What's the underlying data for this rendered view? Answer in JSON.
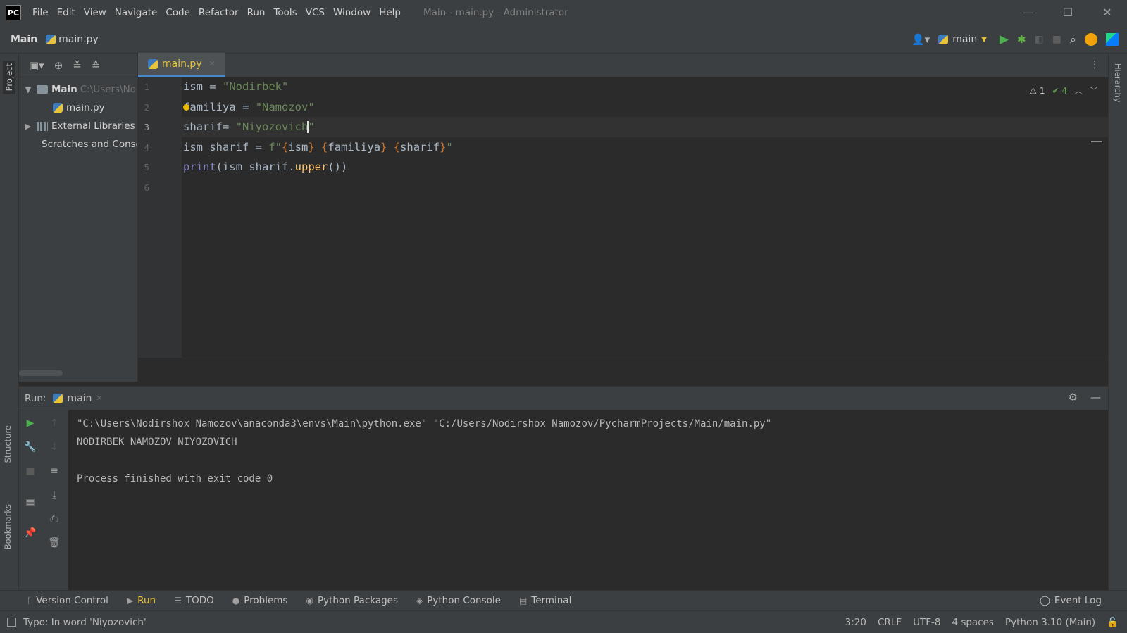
{
  "app": {
    "logo": "PC",
    "window_title": "Main - main.py - Administrator",
    "menu": [
      "File",
      "Edit",
      "View",
      "Navigate",
      "Code",
      "Refactor",
      "Run",
      "Tools",
      "VCS",
      "Window",
      "Help"
    ],
    "controls": {
      "minimize": "—",
      "maximize": "☐",
      "close": "✕"
    }
  },
  "navbar": {
    "project": "Main",
    "file": "main.py",
    "run_config": "main"
  },
  "left_strip": {
    "project": "Project",
    "structure": "Structure",
    "bookmarks": "Bookmarks"
  },
  "right_strip": {
    "hierarchy": "Hierarchy"
  },
  "project_tree": {
    "root": "Main",
    "root_path": "C:\\Users\\No",
    "file": "main.py",
    "external": "External Libraries",
    "scratches": "Scratches and Consoles"
  },
  "editor": {
    "tab": "main.py",
    "line_numbers": [
      "1",
      "2",
      "3",
      "4",
      "5",
      "6"
    ],
    "current_line": "3",
    "inspections": {
      "warnings": "1",
      "ok": "4"
    },
    "code": {
      "l1_var": "ism",
      "l1_op": " = ",
      "l1_str": "\"Nodirbek\"",
      "l2_var_a": "f",
      "l2_var_b": "miliya",
      "l2_op": " = ",
      "l2_str": "\"Namozov\"",
      "l3_var": "sharif",
      "l3_op": "= ",
      "l3_str_a": "\"Niyozovich",
      "l3_str_b": "\"",
      "l4_var": "ism_sharif",
      "l4_op": " = ",
      "l4_prefix": "f",
      "l4_q1": "\"",
      "l4_o1": "{",
      "l4_v1": "ism",
      "l4_c1": "}",
      "l4_sp1": " ",
      "l4_o2": "{",
      "l4_v2": "familiya",
      "l4_c2": "}",
      "l4_sp2": " ",
      "l4_o3": "{",
      "l4_v3": "sharif",
      "l4_c3": "}",
      "l4_q2": "\"",
      "l5_fn": "print",
      "l5_p1": "(",
      "l5_arg": "ism_sharif.",
      "l5_method": "upper",
      "l5_p2": "())"
    }
  },
  "run": {
    "label": "Run:",
    "tab": "main",
    "output": [
      "\"C:\\Users\\Nodirshox Namozov\\anaconda3\\envs\\Main\\python.exe\" \"C:/Users/Nodirshox Namozov/PycharmProjects/Main/main.py\"",
      "NODIRBEK NAMOZOV NIYOZOVICH",
      "",
      "Process finished with exit code 0"
    ]
  },
  "bottom_tabs": [
    "Version Control",
    "Run",
    "TODO",
    "Problems",
    "Python Packages",
    "Python Console",
    "Terminal"
  ],
  "event_log": "Event Log",
  "status": {
    "message": "Typo: In word 'Niyozovich'",
    "position": "3:20",
    "line_sep": "CRLF",
    "encoding": "UTF-8",
    "indent": "4 spaces",
    "interpreter": "Python 3.10 (Main)"
  },
  "colors": {
    "accent": "#e8c43a",
    "run_green": "#4caf50",
    "string": "#6a8759",
    "keyword": "#cc7832",
    "function": "#ffc66d"
  }
}
